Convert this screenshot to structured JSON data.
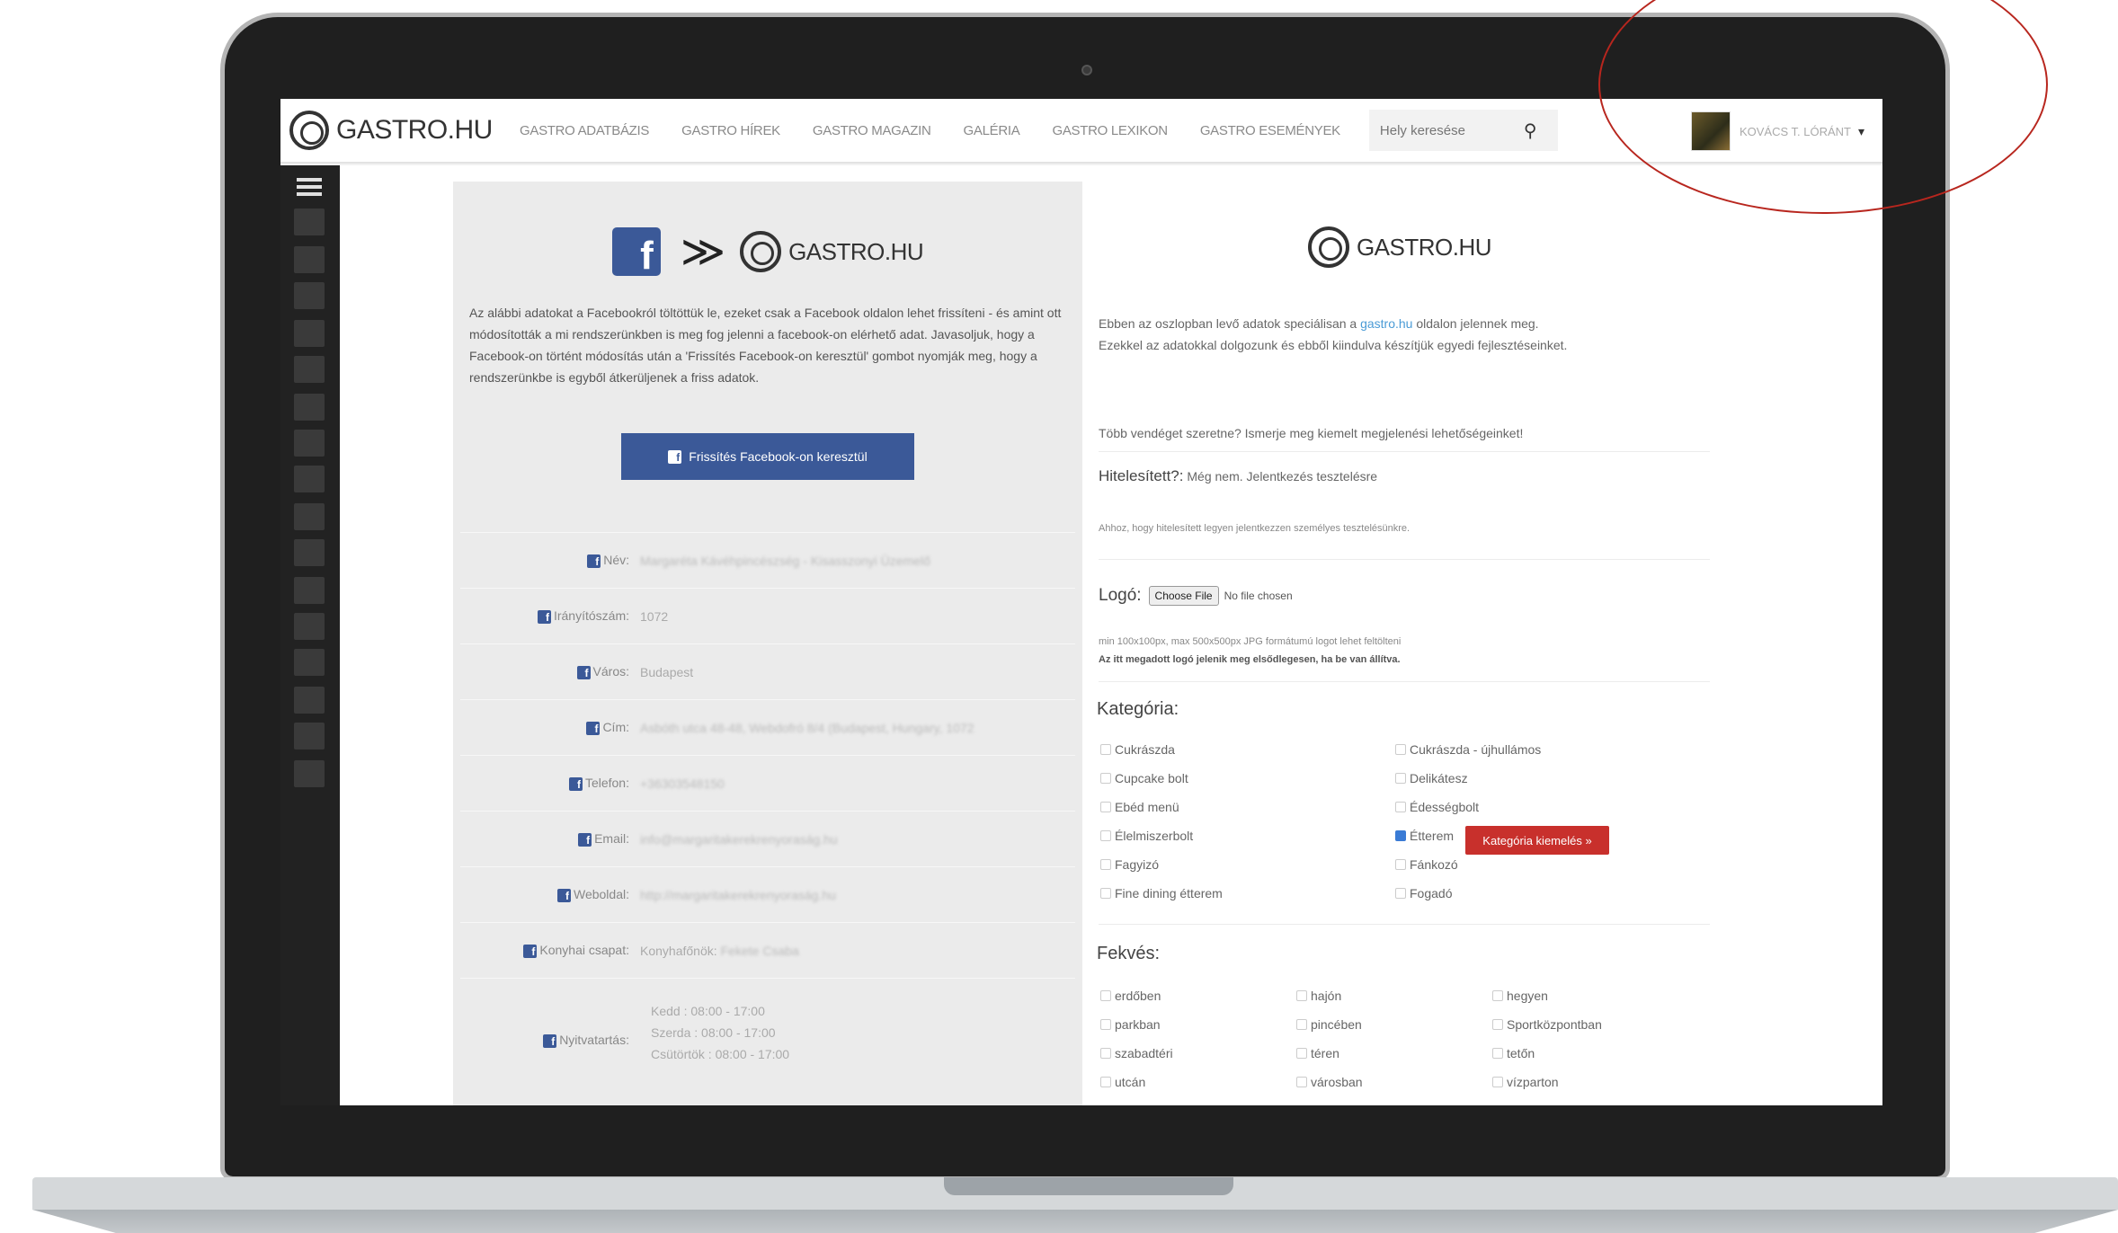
{
  "topbar": {
    "logo_text": "GASTRO.HU",
    "nav": [
      "GASTRO ADATBÁZIS",
      "GASTRO HÍREK",
      "GASTRO MAGAZIN",
      "GALÉRIA",
      "GASTRO LEXIKON",
      "GASTRO ESEMÉNYEK"
    ],
    "search_placeholder": "Hely keresése",
    "search_icon": "magnifier-icon",
    "user_name": "KOVÁCS T. LÓRÁNT",
    "caret": "▾"
  },
  "left": {
    "fb_letter": "f",
    "arrows": "≫",
    "logo_text": "GASTRO.HU",
    "description": "Az alábbi adatokat a Facebookról töltöttük le, ezeket csak a Facebook oldalon lehet frissíteni - és amint ott módosították a mi rendszerünkben is meg fog jelenni a facebook-on elérhető adat. Javasoljuk, hogy a Facebook-on történt módosítás után a 'Frissítés Facebook-on keresztül' gombot nyomják meg, hogy a rendszerünkbe is egyből átkerüljenek a friss adatok.",
    "button_label": "Frissítés Facebook-on keresztül",
    "fields": [
      {
        "label": "Név:",
        "value": "Margaréta Kávéhpincészség - Kisasszonyi Üzemelő"
      },
      {
        "label": "Irányítószám:",
        "value": "1072"
      },
      {
        "label": "Város:",
        "value": "Budapest"
      },
      {
        "label": "Cím:",
        "value": "Asbóth utca 48-48, Webdofró 8/4 (Budapest, Hungary, 1072"
      },
      {
        "label": "Telefon:",
        "value": "+36303548150"
      },
      {
        "label": "Email:",
        "value": "info@margaritakerekrenyoraság.hu"
      },
      {
        "label": "Weboldal:",
        "value": "http://margaritakerekrenyoraság.hu"
      },
      {
        "label": "Konyhai csapat:",
        "value_prefix": "Konyhafőnök:",
        "value": "Fekete Csaba"
      }
    ],
    "hours_label": "Nyitvatartás:",
    "hours": [
      "Kedd : 08:00 - 17:00",
      "Szerda : 08:00 - 17:00",
      "Csütörtök : 08:00 - 17:00"
    ]
  },
  "right": {
    "logo_text": "GASTRO.HU",
    "intro_1": "Ebben az oszlopban levő adatok speciálisan a ",
    "intro_link": "gastro.hu",
    "intro_2": " oldalon jelennek meg.",
    "intro_line2": "Ezekkel az adatokkal dolgozunk és ebből kiindulva készítjük egyedi fejlesztéseinket.",
    "promo": "Több vendéget szeretne? Ismerje meg kiemelt megjelenési lehetőségeinket!",
    "hitel_label": "Hitelesített?:",
    "hitel_value": " Még nem. ",
    "hitel_link": "Jelentkezés",
    "hitel_suffix": " tesztelésre",
    "hitel_note": "Ahhoz, hogy hitelesített legyen jelentkezzen személyes tesztelésünkre.",
    "logo_label": "Logó:",
    "file_button": "Choose File",
    "file_status": "No file chosen",
    "logo_note": "min 100x100px, max 500x500px JPG formátumú logot lehet feltölteni",
    "logo_note_bold": "Az itt megadott logó jelenik meg elsődlegesen, ha be van állítva.",
    "category_title": "Kategória:",
    "categories_left": [
      "Cukrászda",
      "Cupcake bolt",
      "Ebéd menü",
      "Élelmiszerbolt",
      "Fagyizó",
      "Fine dining étterem"
    ],
    "categories_right": [
      "Cukrászda - újhullámos",
      "Delikátesz",
      "Édességbolt",
      "Étterem",
      "Fánkozó",
      "Fogadó"
    ],
    "highlight_button": "Kategória kiemelés »",
    "location_title": "Fekvés:",
    "locations_col1": [
      "erdőben",
      "parkban",
      "szabadtéri",
      "utcán"
    ],
    "locations_col2": [
      "hajón",
      "pincében",
      "téren",
      "városban"
    ],
    "locations_col3": [
      "hegyen",
      "Sportközpontban",
      "tetőn",
      "vízparton"
    ]
  },
  "colors": {
    "facebook_blue": "#3b5998",
    "accent_red": "#c8302c",
    "annotation_circle": "#b8261e"
  }
}
